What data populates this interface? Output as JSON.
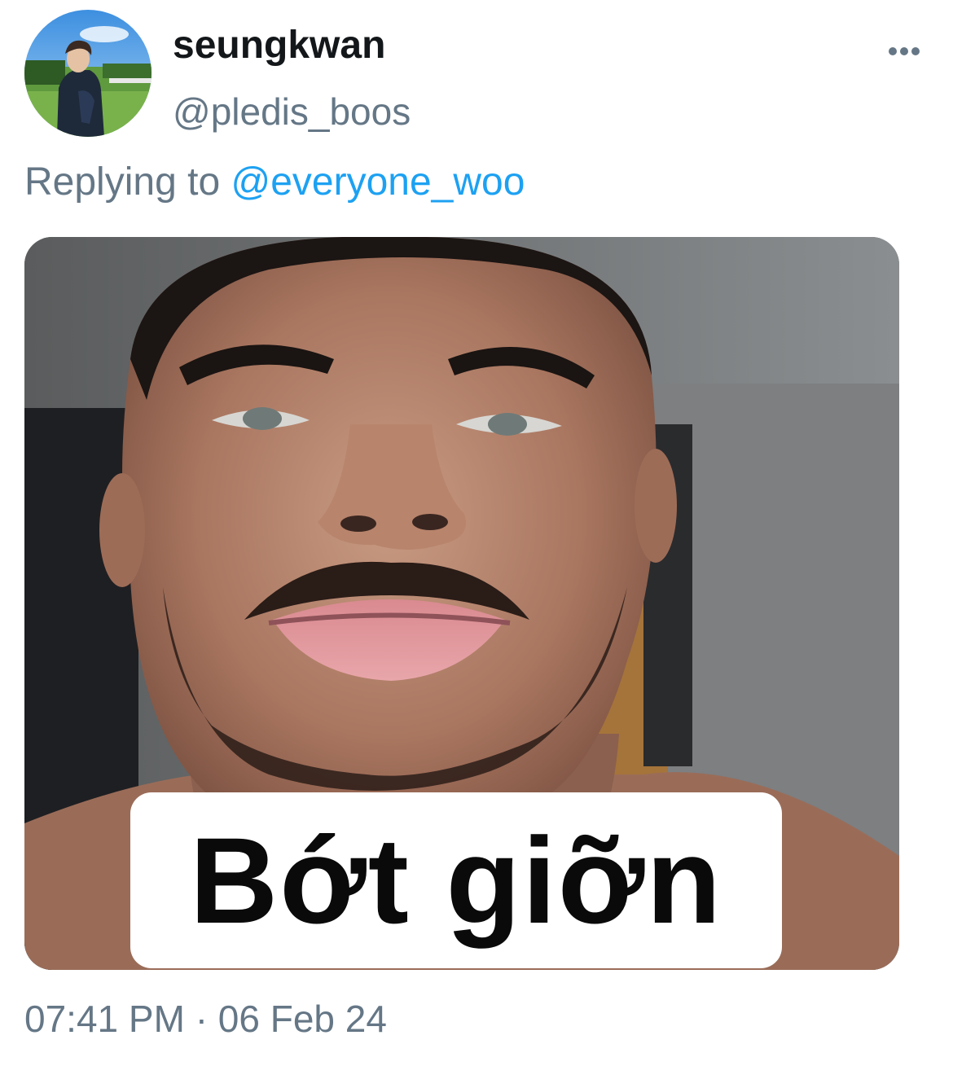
{
  "tweet": {
    "display_name": "seungkwan",
    "handle": "@pledis_boos",
    "reply_prefix": "Replying to",
    "reply_mention": "@everyone_woo",
    "media_caption": "Bớt giỡn",
    "time": "07:41 PM",
    "separator": "·",
    "date": "06 Feb 24",
    "more_icon": "more-horizontal-icon"
  },
  "colors": {
    "text_primary": "#14171a",
    "text_secondary": "#657786",
    "link": "#1da1f2"
  }
}
